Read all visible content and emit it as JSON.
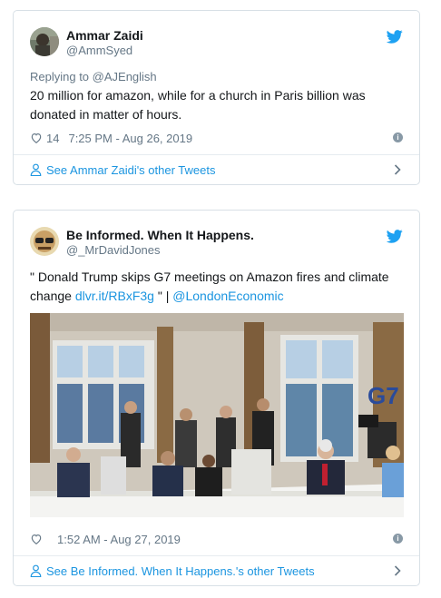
{
  "tweet1": {
    "name": "Ammar Zaidi",
    "handle": "@AmmSyed",
    "replying_prefix": "Replying to ",
    "replying_to": "@AJEnglish",
    "text": "20 million for amazon, while for a church in Paris billion was donated in matter of hours.",
    "likes": "14",
    "time": "7:25 PM - Aug 26, 2019",
    "footer": "See Ammar Zaidi's other Tweets"
  },
  "tweet2": {
    "name": "Be Informed. When It Happens.",
    "handle": "@_MrDavidJones",
    "text_start": "\" Donald Trump skips G7 meetings on Amazon fires and climate change ",
    "link1": "dlvr.it/RBxF3g",
    "text_mid": " \" | ",
    "link2": "@LondonEconomic",
    "photo_sign": "G7",
    "time": "1:52 AM - Aug 27, 2019",
    "footer": "See Be Informed. When It Happens.'s other Tweets"
  },
  "icons": {
    "bird": "twitter-bird-icon",
    "heart": "heart-icon",
    "info": "info-icon",
    "person": "person-icon",
    "chevron": "chevron-right-icon"
  },
  "colors": {
    "link": "#1b95e0",
    "secondary_text": "#657786",
    "border": "#d8e0e6"
  }
}
